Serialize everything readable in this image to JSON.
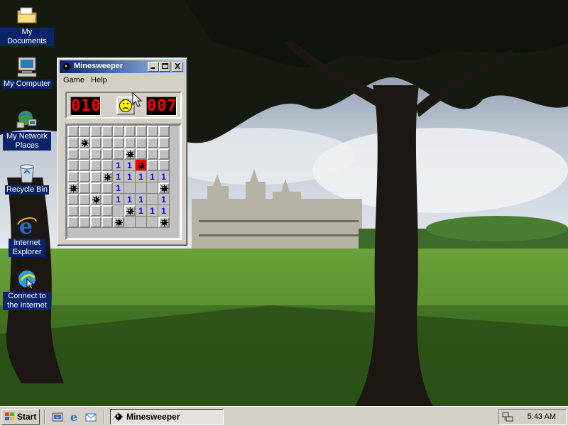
{
  "desktop": {
    "icons": [
      {
        "label": "My Documents",
        "icon": "folder-icon"
      },
      {
        "label": "My Computer",
        "icon": "computer-icon"
      },
      {
        "label": "My Network Places",
        "icon": "network-icon"
      },
      {
        "label": "Recycle Bin",
        "icon": "recycle-bin-icon"
      },
      {
        "label": "Internet Explorer",
        "icon": "internet-explorer-icon"
      },
      {
        "label": "Connect to the Internet",
        "icon": "connect-icon"
      }
    ]
  },
  "window": {
    "title": "Minesweeper",
    "menu": [
      "Game",
      "Help"
    ],
    "mines_left": "010",
    "timer": "007",
    "face": "sad-face",
    "rows": [
      [
        "c",
        "c",
        "c",
        "c",
        "c",
        "c",
        "c",
        "c",
        "c"
      ],
      [
        "c",
        "m",
        "c",
        "c",
        "c",
        "c",
        "c",
        "c",
        "c"
      ],
      [
        "c",
        "c",
        "c",
        "c",
        "c",
        "m",
        "c",
        "c",
        "c"
      ],
      [
        "c",
        "c",
        "c",
        "c",
        "1",
        "1",
        "x",
        "c",
        "c"
      ],
      [
        "c",
        "c",
        "c",
        "m",
        "1",
        "1",
        "1",
        "1",
        "1"
      ],
      [
        "m",
        "c",
        "c",
        "c",
        "1",
        "",
        "",
        "",
        "m"
      ],
      [
        "c",
        "c",
        "m",
        "c",
        "1",
        "1",
        "1",
        "",
        "1"
      ],
      [
        "c",
        "c",
        "c",
        "c",
        "",
        "m",
        "1",
        "1",
        "1"
      ],
      [
        "c",
        "c",
        "c",
        "c",
        "m",
        "",
        "",
        "",
        "m"
      ]
    ]
  },
  "taskbar": {
    "start_label": "Start",
    "task_label": "Minesweeper",
    "clock": "5:43 AM"
  },
  "colors": {
    "desktop_label_bg": "#0a246a",
    "titlebar_start": "#0a246a",
    "titlebar_end": "#a6caf0",
    "number_one": "#0000ff",
    "exploded_cell": "#ff0000"
  }
}
